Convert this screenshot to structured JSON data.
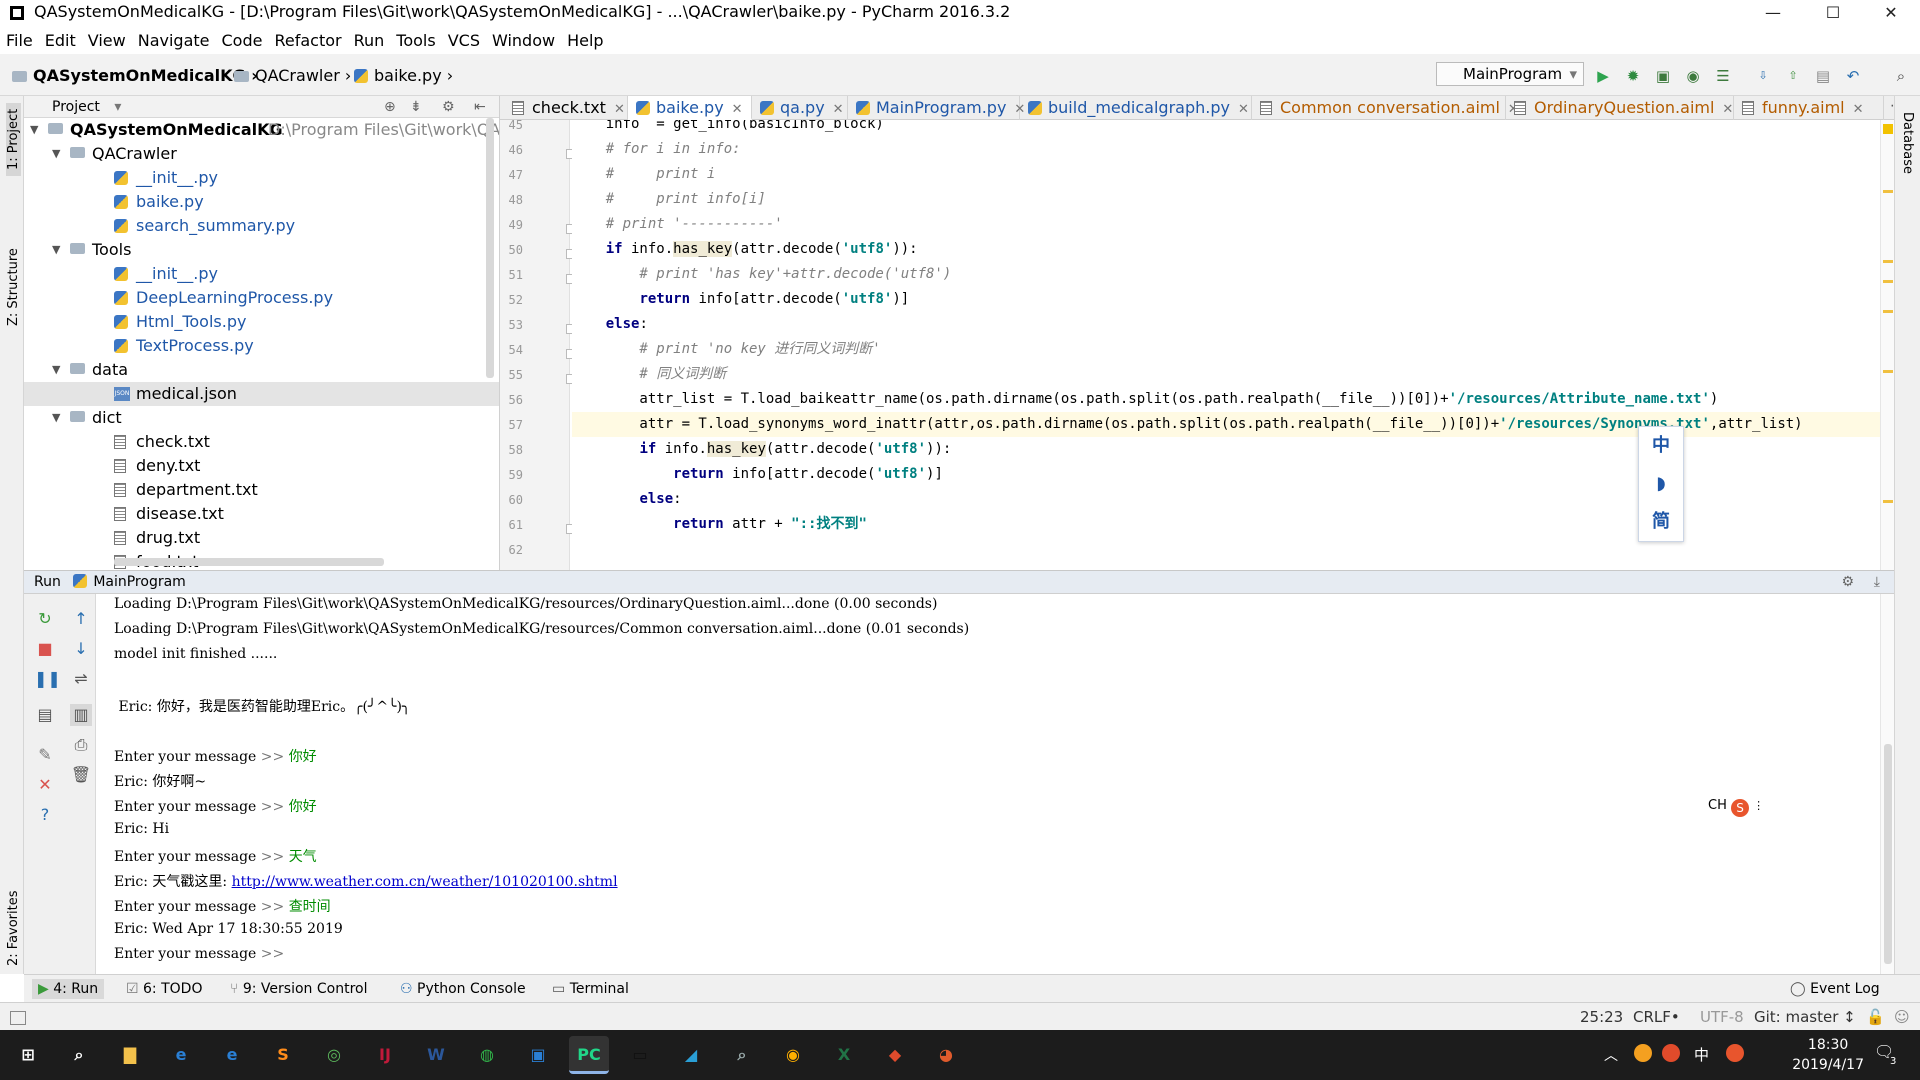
{
  "window": {
    "title": "QASystemOnMedicalKG - [D:\\Program Files\\Git\\work\\QASystemOnMedicalKG] - ...\\QACrawler\\baike.py - PyCharm 2016.3.2",
    "minimize": "—",
    "maximize": "☐",
    "close": "✕"
  },
  "menu": [
    "File",
    "Edit",
    "View",
    "Navigate",
    "Code",
    "Refactor",
    "Run",
    "Tools",
    "VCS",
    "Window",
    "Help"
  ],
  "breadcrumb": [
    "QASystemOnMedicalKG",
    "QACrawler",
    "baike.py"
  ],
  "run_config": "MainProgram",
  "toolbar_icons": [
    "run-icon",
    "debug-icon",
    "coverage-icon",
    "profile-icon",
    "concurrency-icon",
    "vcs-update-icon",
    "vcs-commit-icon",
    "history-icon",
    "revert-icon",
    "search-icon"
  ],
  "left_stripe": {
    "project": "1: Project",
    "structure": "Z: Structure",
    "favorites": "2: Favorites"
  },
  "right_stripe": {
    "database": "Database"
  },
  "project": {
    "header": "Project",
    "root": {
      "name": "QASystemOnMedicalKG",
      "path": "D:\\Program Files\\Git\\work\\QASy"
    },
    "rows": [
      {
        "name": "QACrawler",
        "kind": "folder",
        "depth": 1,
        "open": true
      },
      {
        "name": "__init__.py",
        "kind": "py",
        "depth": 2
      },
      {
        "name": "baike.py",
        "kind": "py",
        "depth": 2
      },
      {
        "name": "search_summary.py",
        "kind": "py",
        "depth": 2
      },
      {
        "name": "Tools",
        "kind": "folder",
        "depth": 1,
        "open": true
      },
      {
        "name": "__init__.py",
        "kind": "py",
        "depth": 2
      },
      {
        "name": "DeepLearningProcess.py",
        "kind": "py",
        "depth": 2
      },
      {
        "name": "Html_Tools.py",
        "kind": "py",
        "depth": 2
      },
      {
        "name": "TextProcess.py",
        "kind": "py",
        "depth": 2
      },
      {
        "name": "data",
        "kind": "folder",
        "depth": 1,
        "open": true
      },
      {
        "name": "medical.json",
        "kind": "json",
        "depth": 2,
        "selected": true
      },
      {
        "name": "dict",
        "kind": "folder",
        "depth": 1,
        "open": true
      },
      {
        "name": "check.txt",
        "kind": "txt",
        "depth": 2
      },
      {
        "name": "deny.txt",
        "kind": "txt",
        "depth": 2
      },
      {
        "name": "department.txt",
        "kind": "txt",
        "depth": 2
      },
      {
        "name": "disease.txt",
        "kind": "txt",
        "depth": 2
      },
      {
        "name": "drug.txt",
        "kind": "txt",
        "depth": 2
      },
      {
        "name": "food.txt",
        "kind": "txt",
        "depth": 2
      }
    ]
  },
  "tabs": [
    {
      "label": "check.txt",
      "type": "txt"
    },
    {
      "label": "baike.py",
      "type": "py",
      "active": true
    },
    {
      "label": "qa.py",
      "type": "py"
    },
    {
      "label": "MainProgram.py",
      "type": "py"
    },
    {
      "label": "build_medicalgraph.py",
      "type": "py"
    },
    {
      "label": "Common conversation.aiml",
      "type": "aiml"
    },
    {
      "label": "OrdinaryQuestion.aiml",
      "type": "aiml"
    },
    {
      "label": "funny.aiml",
      "type": "aiml"
    }
  ],
  "code_lines": [
    {
      "n": "45",
      "t": "    info  = get_info(basicInfo_block)"
    },
    {
      "n": "46",
      "t": "    # for i in info:",
      "c": true
    },
    {
      "n": "47",
      "t": "    #     print i",
      "c": true
    },
    {
      "n": "48",
      "t": "    #     print info[i]",
      "c": true
    },
    {
      "n": "49",
      "t": "    # print '-----------'",
      "c": true
    },
    {
      "n": "50",
      "t": "    if info.has_key(attr.decode('utf8')):"
    },
    {
      "n": "51",
      "t": "        # print 'has key'+attr.decode('utf8')",
      "c": true
    },
    {
      "n": "52",
      "t": "        return info[attr.decode('utf8')]"
    },
    {
      "n": "53",
      "t": "    else:"
    },
    {
      "n": "54",
      "t": "        # print 'no key 进行同义词判断'",
      "c": true
    },
    {
      "n": "55",
      "t": "        # 同义词判断",
      "c": true
    },
    {
      "n": "56",
      "t": "        attr_list = T.load_baikeattr_name(os.path.dirname(os.path.split(os.path.realpath(__file__))[0])+'/resources/Attribute_name.txt')"
    },
    {
      "n": "57",
      "t": "        attr = T.load_synonyms_word_inattr(attr,os.path.dirname(os.path.split(os.path.realpath(__file__))[0])+'/resources/Synonyms.txt',attr_list)",
      "cur": true
    },
    {
      "n": "58",
      "t": "        if info.has_key(attr.decode('utf8')):"
    },
    {
      "n": "59",
      "t": "            return info[attr.decode('utf8')]"
    },
    {
      "n": "60",
      "t": "        else:"
    },
    {
      "n": "61",
      "t": "            return attr + \"::找不到\""
    },
    {
      "n": "62",
      "t": ""
    }
  ],
  "ime_float": [
    "中",
    "◗",
    "简"
  ],
  "run": {
    "label": "Run",
    "config": "MainProgram",
    "lines": [
      {
        "t": "Loading D:\\Program Files\\Git\\work\\QASystemOnMedicalKG/resources/OrdinaryQuestion.aiml...done (0.00 seconds)"
      },
      {
        "t": "Loading D:\\Program Files\\Git\\work\\QASystemOnMedicalKG/resources/Common conversation.aiml...done (0.01 seconds)"
      },
      {
        "t": "model init finished ......"
      },
      {
        "t": ""
      },
      {
        "t": " Eric: 你好，我是医药智能助理Eric。╭(╯^╰)╮"
      },
      {
        "t": ""
      },
      {
        "p": "Enter your message ",
        "sep": ">> ",
        "u": "你好"
      },
      {
        "t": "Eric: 你好啊~"
      },
      {
        "p": "Enter your message ",
        "sep": ">> ",
        "u": "你好"
      },
      {
        "t": "Eric: Hi"
      },
      {
        "p": "Enter your message ",
        "sep": ">> ",
        "u": "天气"
      },
      {
        "t": "Eric: 天气戳这里: ",
        "link": "http://www.weather.com.cn/weather/101020100.shtml"
      },
      {
        "p": "Enter your message ",
        "sep": ">> ",
        "u": "查时间"
      },
      {
        "t": "Eric: Wed Apr 17 18:30:55 2019"
      },
      {
        "p": "Enter your message ",
        "sep": ">> ",
        "u": ""
      }
    ]
  },
  "ch_indicator": "CH",
  "toolwindows": [
    {
      "label": "4: Run",
      "active": true
    },
    {
      "label": "6: TODO"
    },
    {
      "label": "9: Version Control"
    },
    {
      "label": "Python Console"
    },
    {
      "label": "Terminal"
    }
  ],
  "event_log": "Event Log",
  "status": {
    "position": "25:23",
    "line_sep": "CRLF•",
    "encoding": "UTF-8",
    "git": "Git: master ↕"
  },
  "taskbar": {
    "apps": [
      "windows-start",
      "search",
      "file-explorer",
      "internet-explorer",
      "edge",
      "sublime-text",
      "browser-360",
      "intellij",
      "word",
      "wechat",
      "app-window",
      "pycharm",
      "terminal",
      "stock-app",
      "search-tool",
      "notes",
      "excel",
      "git-tool",
      "game-app"
    ],
    "tray": {
      "ime": "中",
      "time": "18:30",
      "date": "2019/4/17",
      "notif": "3"
    }
  }
}
